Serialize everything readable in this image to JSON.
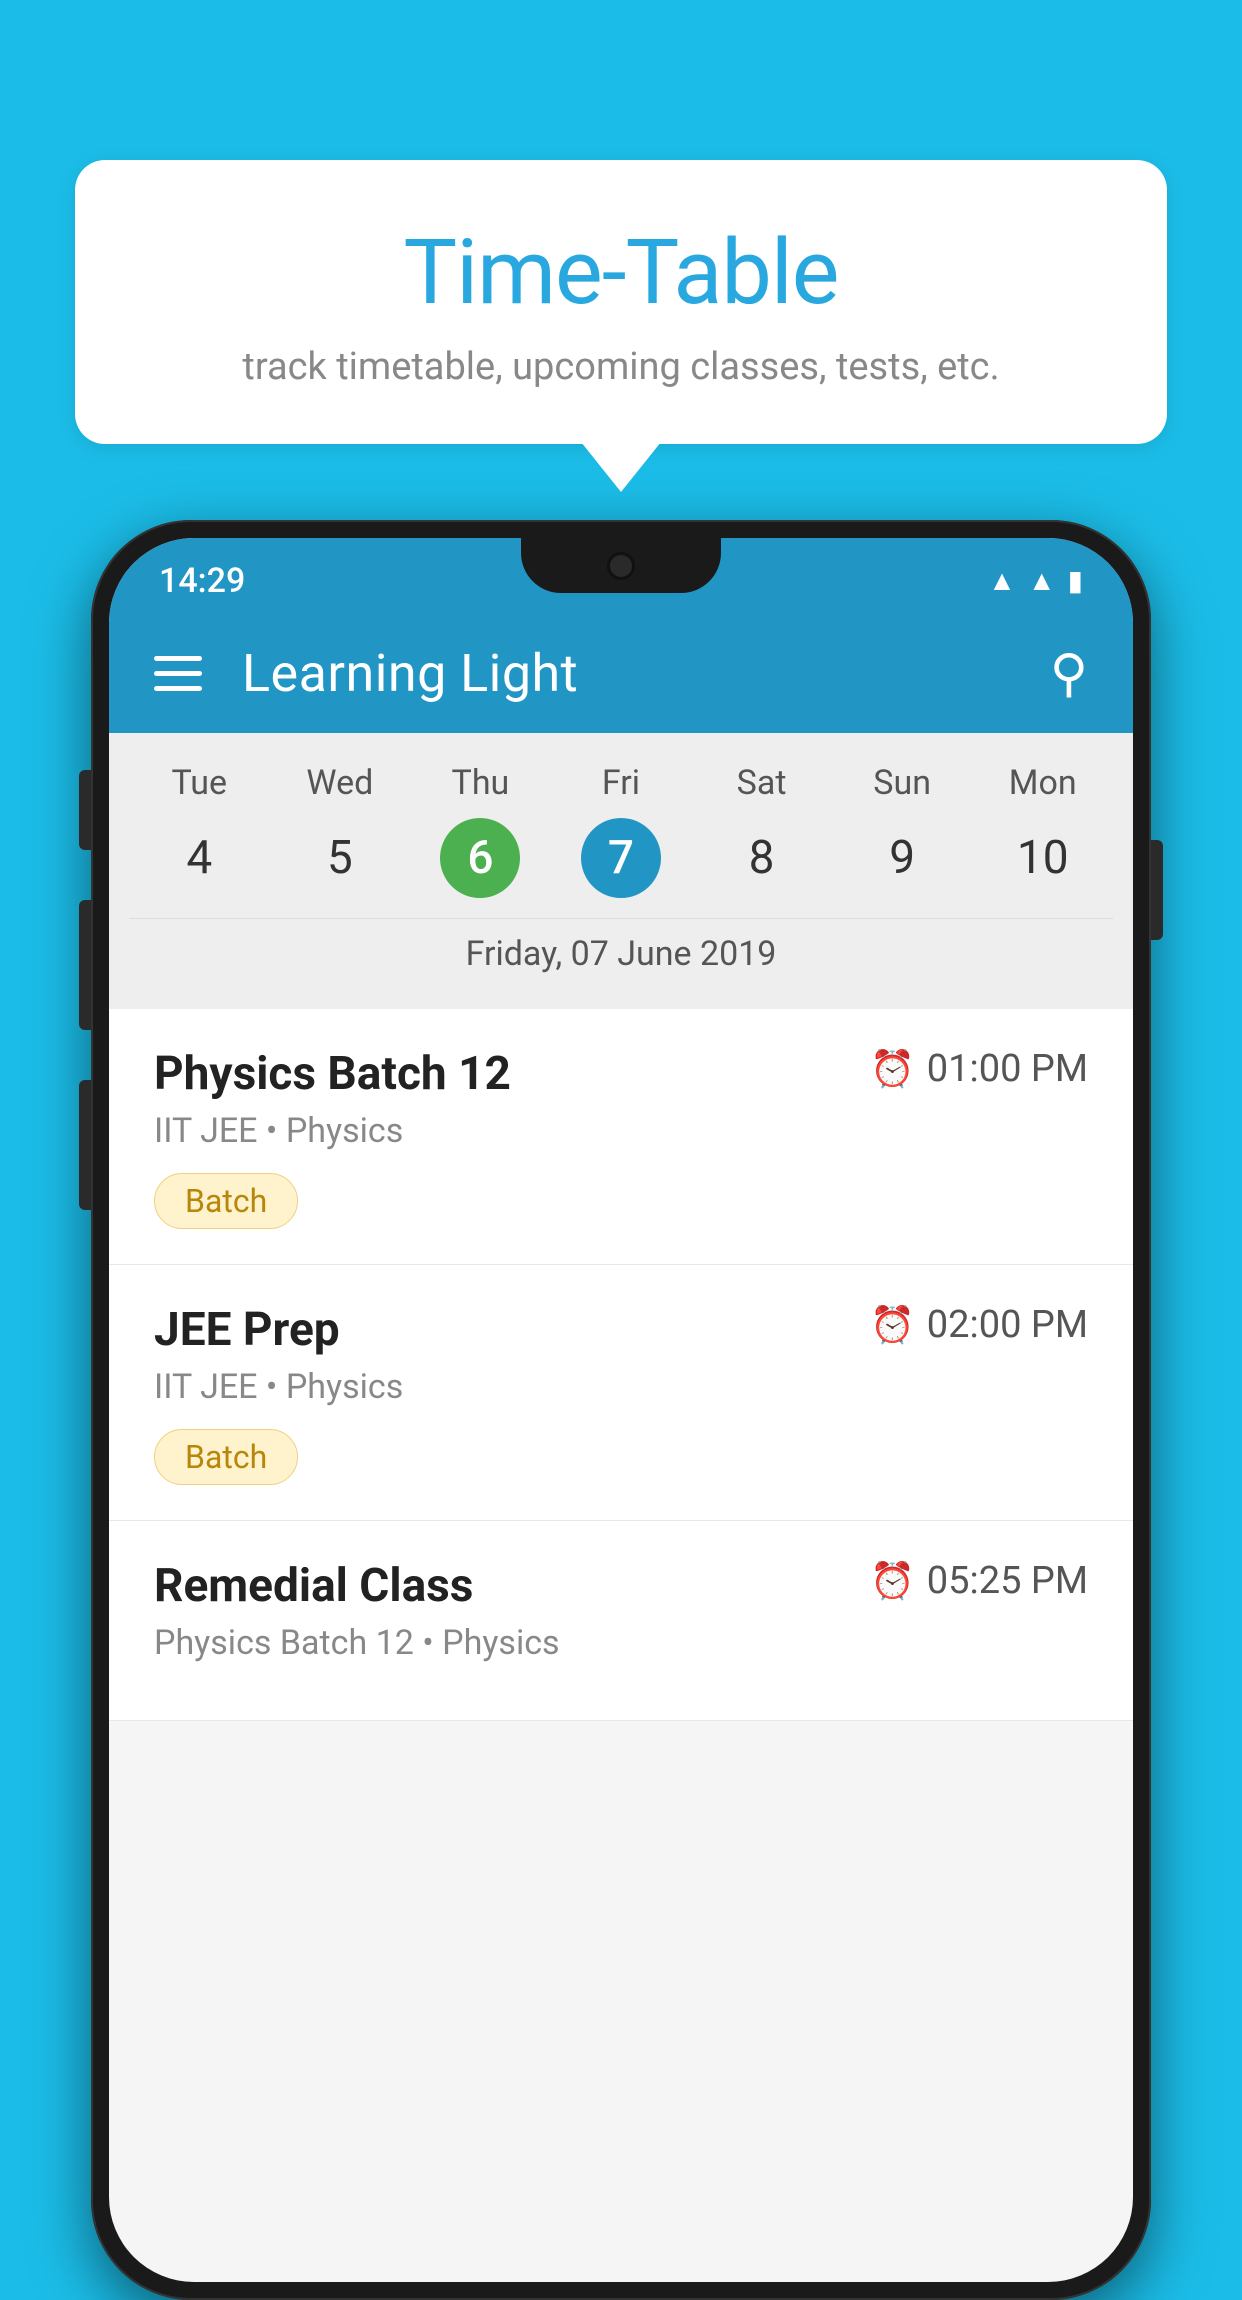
{
  "background": {
    "color": "#1bbde8"
  },
  "tooltip": {
    "title": "Time-Table",
    "subtitle": "track timetable, upcoming classes, tests, etc."
  },
  "phone": {
    "status_bar": {
      "time": "14:29"
    },
    "app_bar": {
      "title": "Learning Light",
      "menu_icon_label": "menu",
      "search_icon_label": "search"
    },
    "calendar": {
      "days": [
        {
          "label": "Tue",
          "number": "4"
        },
        {
          "label": "Wed",
          "number": "5"
        },
        {
          "label": "Thu",
          "number": "6",
          "state": "today"
        },
        {
          "label": "Fri",
          "number": "7",
          "state": "selected"
        },
        {
          "label": "Sat",
          "number": "8"
        },
        {
          "label": "Sun",
          "number": "9"
        },
        {
          "label": "Mon",
          "number": "10"
        }
      ],
      "selected_date": "Friday, 07 June 2019"
    },
    "schedule": [
      {
        "title": "Physics Batch 12",
        "time": "01:00 PM",
        "subtitle": "IIT JEE • Physics",
        "badge": "Batch"
      },
      {
        "title": "JEE Prep",
        "time": "02:00 PM",
        "subtitle": "IIT JEE • Physics",
        "badge": "Batch"
      },
      {
        "title": "Remedial Class",
        "time": "05:25 PM",
        "subtitle": "Physics Batch 12 • Physics",
        "badge": ""
      }
    ]
  }
}
